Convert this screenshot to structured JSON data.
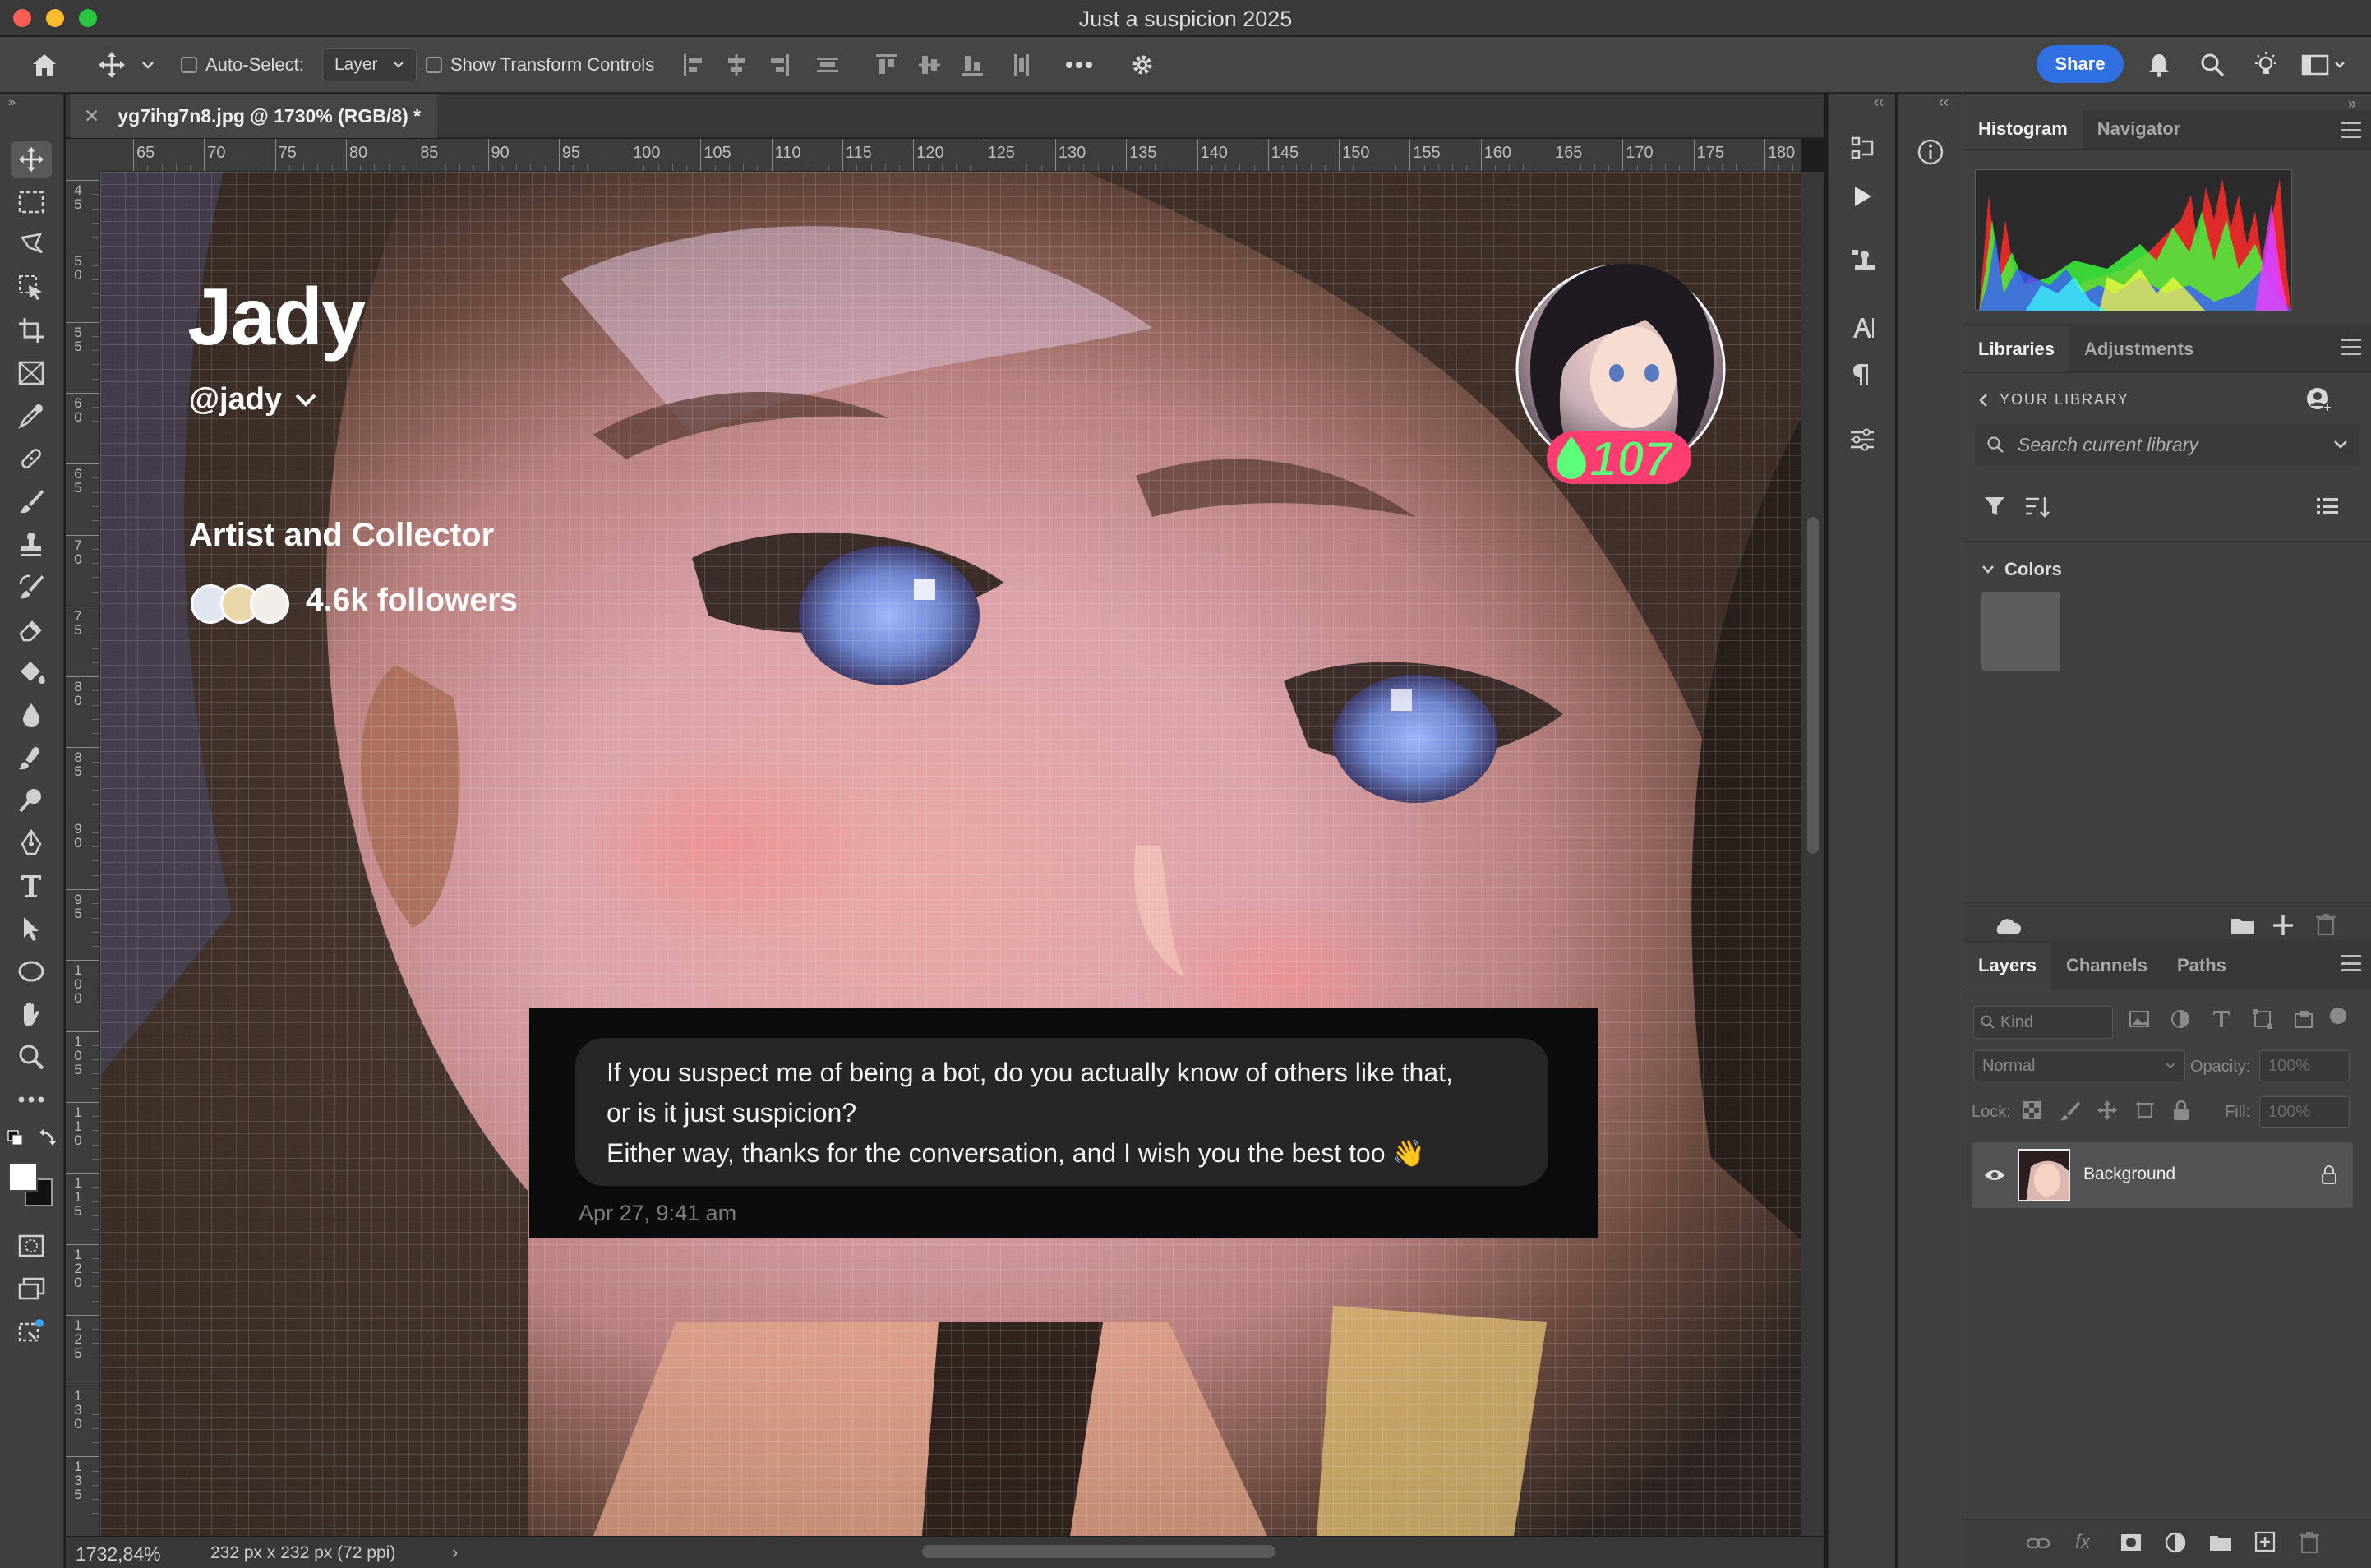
{
  "window": {
    "title": "Just a suspicion 2025"
  },
  "options_bar": {
    "auto_select_label": "Auto-Select:",
    "auto_select_target": "Layer",
    "show_transform_label": "Show Transform Controls",
    "share_label": "Share"
  },
  "document": {
    "tab_title": "yg7ihg7n8.jpg @ 1730% (RGB/8) *",
    "zoom": "1732,84%",
    "dimensions": "232 px x 232 px (72 ppi)"
  },
  "ruler": {
    "top_ticks": [
      "65",
      "70",
      "75",
      "80",
      "85",
      "90",
      "95",
      "100",
      "105",
      "110",
      "115",
      "120",
      "125",
      "130",
      "135",
      "140",
      "145",
      "150",
      "155",
      "160",
      "165",
      "170",
      "175",
      "180"
    ],
    "left_ticks": [
      "45",
      "50",
      "55",
      "60",
      "65",
      "70",
      "75",
      "80",
      "85",
      "90",
      "95",
      "100",
      "105",
      "110",
      "115",
      "120",
      "125",
      "130",
      "135"
    ]
  },
  "canvas_content": {
    "name": "Jady",
    "handle": "@jady",
    "bio": "Artist and Collector",
    "followers": "4.6k followers",
    "badge": "107",
    "message_line1": "If you suspect me of being a bot, do you actually know of others like that,",
    "message_line2": "or is it just suspicion?",
    "message_line3": "Either way, thanks for the conversation, and I wish you the best too 👋",
    "timestamp": "Apr 27, 9:41 am"
  },
  "panels": {
    "histogram_tabs": [
      "Histogram",
      "Navigator"
    ],
    "libraries_tabs": [
      "Libraries",
      "Adjustments"
    ],
    "your_library": "YOUR LIBRARY",
    "search_placeholder": "Search current library",
    "colors_label": "Colors",
    "layers_tabs": [
      "Layers",
      "Channels",
      "Paths"
    ],
    "kind_placeholder": "Kind",
    "blend_mode": "Normal",
    "opacity_label": "Opacity:",
    "opacity_value": "100%",
    "lock_label": "Lock:",
    "fill_label": "Fill:",
    "fill_value": "100%",
    "layer_name": "Background"
  },
  "colors": {
    "accent": "#2f6fe0",
    "badge_red": "#ff3d6e",
    "badge_green": "#5cff7a"
  }
}
